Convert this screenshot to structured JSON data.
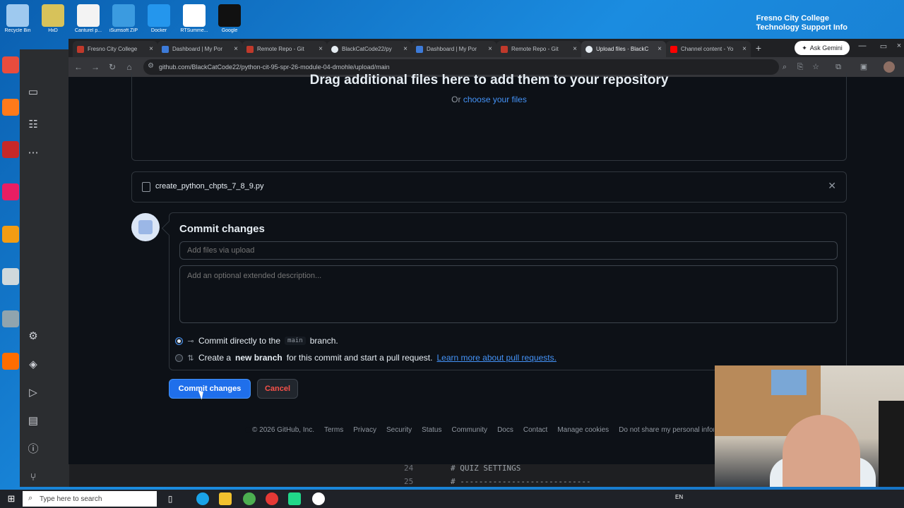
{
  "desktop": {
    "icons_top": [
      {
        "label": "Recycle Bin",
        "color": "#9ec9ef"
      },
      {
        "label": "HxD",
        "color": "#d7c25a"
      },
      {
        "label": "Canturel p...",
        "color": "#f3f3f3"
      },
      {
        "label": "iSumsoft ZIP",
        "color": "#3b9be0"
      },
      {
        "label": "Docker",
        "color": "#2496ed"
      },
      {
        "label": "RTSumme...",
        "color": "#ffffff"
      },
      {
        "label": "Google",
        "color": "#111111"
      }
    ],
    "notice_line1": "Fresno City College",
    "notice_line2": "Technology Support Info"
  },
  "browser": {
    "tabs": [
      {
        "title": "Fresno City College",
        "color": "#c0392b"
      },
      {
        "title": "Dashboard | My Por",
        "color": "#3d7bd9"
      },
      {
        "title": "Remote Repo - Git",
        "color": "#c0392b"
      },
      {
        "title": "BlackCatCode22/py",
        "color": "#e6edf3"
      },
      {
        "title": "Dashboard | My Por",
        "color": "#3d7bd9"
      },
      {
        "title": "Remote Repo - Git",
        "color": "#c0392b"
      },
      {
        "title": "Upload files · BlackC",
        "color": "#e6edf3"
      },
      {
        "title": "Channel content - Yo",
        "color": "#ff0000"
      }
    ],
    "ask_gemini": "Ask Gemini",
    "url": "github.com/BlackCatCode22/python-cit-95-spr-26-module-04-dmohle/upload/main"
  },
  "upload": {
    "drop_title": "Drag additional files here to add them to your repository",
    "or": "Or",
    "choose": "choose your files",
    "file_name": "create_python_chpts_7_8_9.py"
  },
  "commit": {
    "title": "Commit changes",
    "summary_placeholder": "Add files via upload",
    "description_placeholder": "Add an optional extended description...",
    "option1_pre": "Commit directly to the",
    "option1_branch": "main",
    "option1_post": "branch.",
    "option2_pre": "Create a",
    "option2_bold": "new branch",
    "option2_post": "for this commit and start a pull request.",
    "option2_link": "Learn more about pull requests.",
    "commit_button": "Commit changes",
    "cancel_button": "Cancel"
  },
  "footer": {
    "copyright": "© 2026 GitHub, Inc.",
    "links": [
      "Terms",
      "Privacy",
      "Security",
      "Status",
      "Community",
      "Docs",
      "Contact",
      "Manage cookies",
      "Do not share my personal infor"
    ]
  },
  "code": {
    "line1_num": "24",
    "line1_text": "# QUIZ SETTINGS",
    "line2_num": "25",
    "line2_text": "# ----------------------------"
  },
  "taskbar": {
    "search_placeholder": "Type here to search",
    "lang": "EN"
  }
}
